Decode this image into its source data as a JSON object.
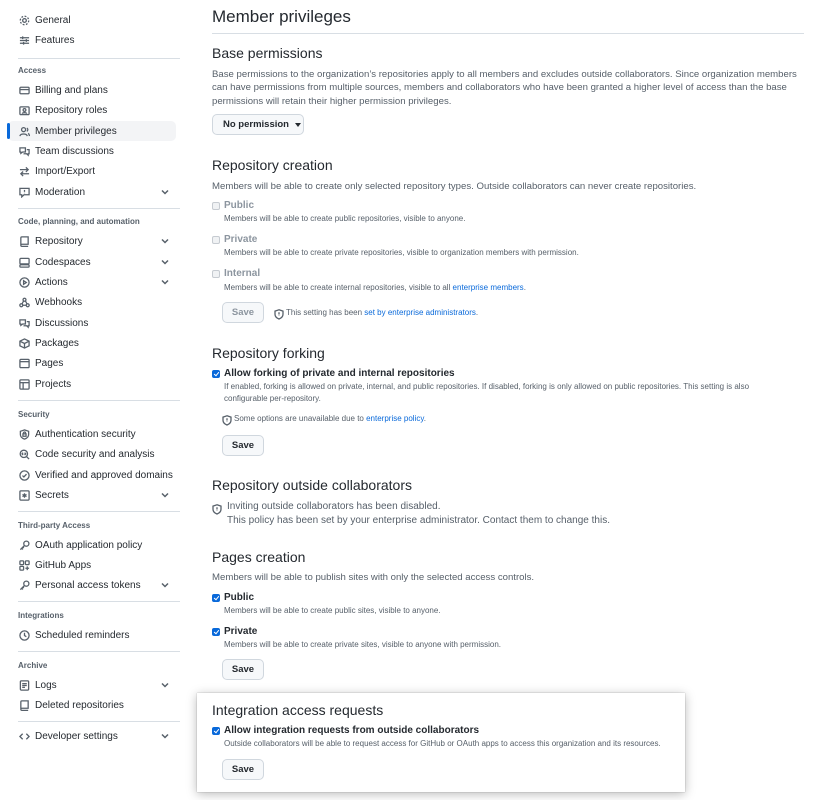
{
  "sidebar": {
    "top": [
      {
        "label": "General",
        "icon": "gear-icon"
      },
      {
        "label": "Features",
        "icon": "sliders-icon"
      }
    ],
    "sections": [
      {
        "heading": "Access",
        "items": [
          {
            "label": "Billing and plans",
            "icon": "credit-card-icon"
          },
          {
            "label": "Repository roles",
            "icon": "id-badge-icon"
          },
          {
            "label": "Member privileges",
            "icon": "person-icon",
            "active": true
          },
          {
            "label": "Team discussions",
            "icon": "comment-discussion-icon"
          },
          {
            "label": "Import/Export",
            "icon": "arrow-switch-icon"
          },
          {
            "label": "Moderation",
            "icon": "report-icon",
            "expandable": true
          }
        ]
      },
      {
        "heading": "Code, planning, and automation",
        "items": [
          {
            "label": "Repository",
            "icon": "repo-icon",
            "expandable": true
          },
          {
            "label": "Codespaces",
            "icon": "codespaces-icon",
            "expandable": true
          },
          {
            "label": "Actions",
            "icon": "play-icon",
            "expandable": true
          },
          {
            "label": "Webhooks",
            "icon": "webhook-icon"
          },
          {
            "label": "Discussions",
            "icon": "comment-discussion-icon"
          },
          {
            "label": "Packages",
            "icon": "package-icon"
          },
          {
            "label": "Pages",
            "icon": "browser-icon"
          },
          {
            "label": "Projects",
            "icon": "table-icon"
          }
        ]
      },
      {
        "heading": "Security",
        "items": [
          {
            "label": "Authentication security",
            "icon": "shield-lock-icon"
          },
          {
            "label": "Code security and analysis",
            "icon": "codescan-icon"
          },
          {
            "label": "Verified and approved domains",
            "icon": "verified-icon"
          },
          {
            "label": "Secrets",
            "icon": "key-asterisk-icon",
            "expandable": true
          }
        ]
      },
      {
        "heading": "Third-party Access",
        "items": [
          {
            "label": "OAuth application policy",
            "icon": "key-icon"
          },
          {
            "label": "GitHub Apps",
            "icon": "apps-icon"
          },
          {
            "label": "Personal access tokens",
            "icon": "key-icon",
            "expandable": true
          }
        ]
      },
      {
        "heading": "Integrations",
        "items": [
          {
            "label": "Scheduled reminders",
            "icon": "clock-icon"
          }
        ]
      },
      {
        "heading": "Archive",
        "items": [
          {
            "label": "Logs",
            "icon": "log-icon",
            "expandable": true
          },
          {
            "label": "Deleted repositories",
            "icon": "repo-deleted-icon"
          }
        ]
      }
    ],
    "bottom": {
      "label": "Developer settings",
      "icon": "code-icon",
      "expandable": true
    }
  },
  "main": {
    "title": "Member privileges",
    "base": {
      "heading": "Base permissions",
      "desc": "Base permissions to the organization’s repositories apply to all members and excludes outside collaborators. Since organization members can have permissions from multiple sources, members and collaborators who have been granted a higher level of access than the base permissions will retain their higher permission privileges.",
      "select_label": "No permission"
    },
    "repo_creation": {
      "heading": "Repository creation",
      "desc": "Members will be able to create only selected repository types. Outside collaborators can never create repositories.",
      "options": [
        {
          "label": "Public",
          "note": "Members will be able to create public repositories, visible to anyone.",
          "checked": false
        },
        {
          "label": "Private",
          "note": "Members will be able to create private repositories, visible to organization members with permission.",
          "checked": false
        },
        {
          "label": "Internal",
          "note_prefix": "Members will be able to create internal repositories, visible to all ",
          "note_link": "enterprise members",
          "note_suffix": ".",
          "checked": false
        }
      ],
      "save_label": "Save",
      "policy_prefix": "This setting has been ",
      "policy_link": "set by enterprise administrators",
      "policy_suffix": "."
    },
    "forking": {
      "heading": "Repository forking",
      "option_label": "Allow forking of private and internal repositories",
      "option_checked": true,
      "note": "If enabled, forking is allowed on private, internal, and public repositories. If disabled, forking is only allowed on public repositories. This setting is also configurable per-repository.",
      "policy_prefix": "Some options are unavailable due to ",
      "policy_link": "enterprise policy",
      "policy_suffix": ".",
      "save_label": "Save"
    },
    "outside": {
      "heading": "Repository outside collaborators",
      "line1": "Inviting outside collaborators has been disabled.",
      "line2": "This policy has been set by your enterprise administrator. Contact them to change this."
    },
    "pages": {
      "heading": "Pages creation",
      "desc": "Members will be able to publish sites with only the selected access controls.",
      "options": [
        {
          "label": "Public",
          "note": "Members will be able to create public sites, visible to anyone.",
          "checked": true
        },
        {
          "label": "Private",
          "note": "Members will be able to create private sites, visible to anyone with permission.",
          "checked": true
        }
      ],
      "save_label": "Save"
    },
    "integration": {
      "heading": "Integration access requests",
      "option_label": "Allow integration requests from outside collaborators",
      "option_checked": true,
      "note": "Outside collaborators will be able to request access for GitHub or OAuth apps to access this organization and its resources.",
      "save_label": "Save"
    }
  }
}
